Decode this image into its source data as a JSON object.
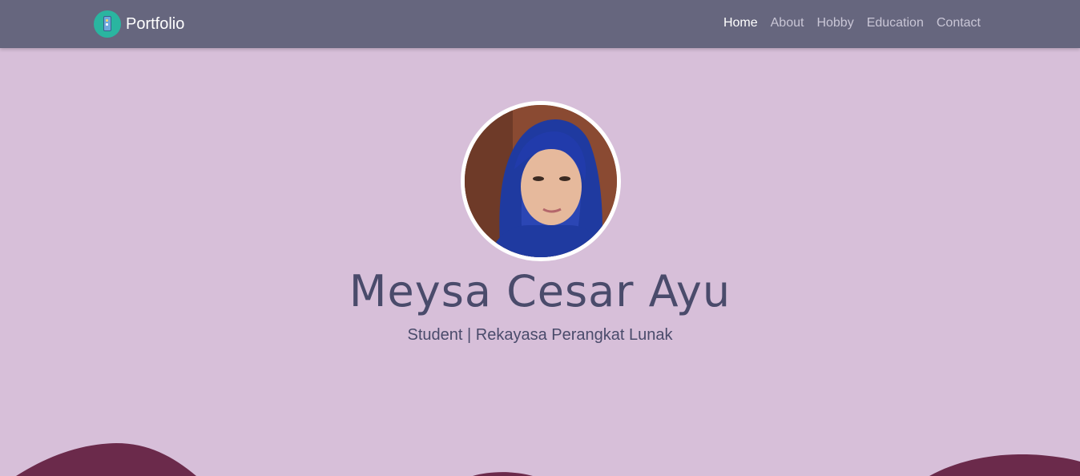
{
  "navbar": {
    "brand_text": "Portfolio",
    "brand_icon": "phone-icon",
    "links": [
      "Home",
      "About",
      "Hobby",
      "Education",
      "Contact"
    ],
    "active_link": "Home"
  },
  "hero": {
    "name": "Meysa Cesar Ayu",
    "subtitle": "Student | Rekayasa Perangkat Lunak"
  },
  "colors": {
    "navbar": "#66667e",
    "background": "#d7bfd9",
    "wave": "#6b2a4b",
    "text": "#4a4b6b",
    "brand_logo": "#2ab5a0"
  }
}
